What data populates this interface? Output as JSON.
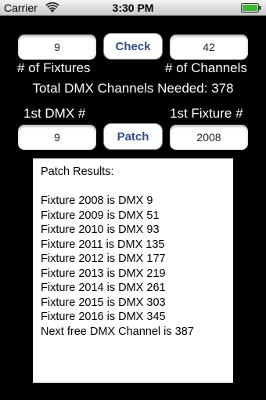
{
  "status_bar": {
    "carrier": "Carrier",
    "time": "3:30 PM",
    "icons": [
      "wifi-icon",
      "battery-icon"
    ]
  },
  "fixtures": {
    "count_value": "9",
    "count_label": "# of Fixtures",
    "check_label": "Check",
    "channels_value": "42",
    "channels_label": "# of Channels"
  },
  "total_text": "Total DMX Channels Needed: 378",
  "patch": {
    "dmx_label": "1st DMX #",
    "fixture_label": "1st Fixture #",
    "dmx_value": "9",
    "patch_label": "Patch",
    "fixture_value": "2008"
  },
  "results": {
    "heading": "Patch Results:",
    "lines": [
      "Fixture 2008 is DMX 9",
      "Fixture 2009 is DMX 51",
      "Fixture 2010 is DMX 93",
      "Fixture 2011 is DMX 135",
      "Fixture 2012 is DMX 177",
      "Fixture 2013 is DMX 219",
      "Fixture 2014 is DMX 261",
      "Fixture 2015 is DMX 303",
      "Fixture 2016 is DMX 345",
      "Next free DMX Channel is 387"
    ]
  },
  "colors": {
    "background": "#000000",
    "button_text": "#2f4f86",
    "battery_fill": "#3db535"
  }
}
